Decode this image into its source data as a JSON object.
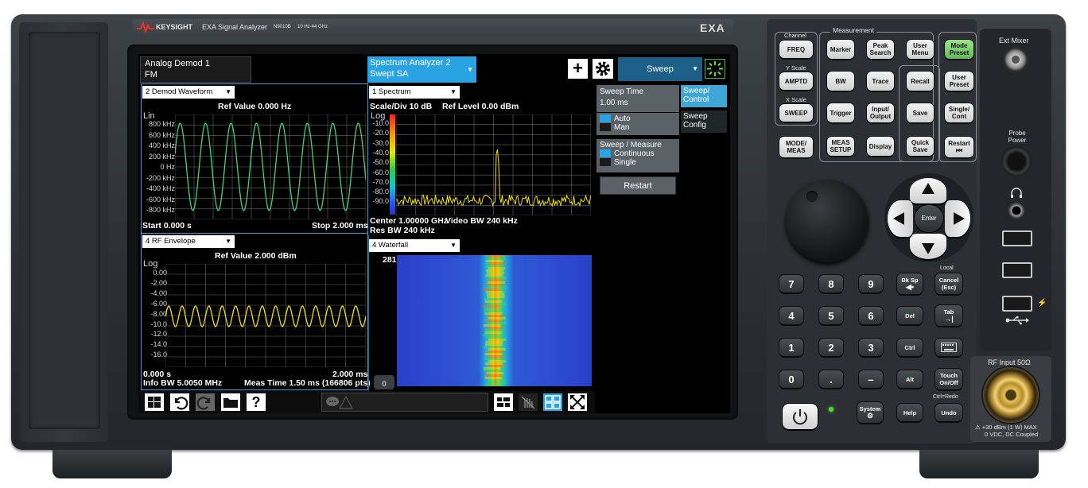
{
  "brand": {
    "name": "KEYSIGHT",
    "product": "EXA Signal Analyzer",
    "model": "N9010B",
    "range": "10 Hz-44 GHz",
    "badge": "EXA"
  },
  "screen": {
    "tabs": [
      {
        "line1": "Analog Demod 1",
        "line2": "FM"
      },
      {
        "line1": "Spectrum Analyzer 2",
        "line2": "Swept SA"
      }
    ],
    "add_label": "+",
    "menu_title": "Sweep",
    "panels": {
      "demod_waveform": {
        "selector": "2 Demod Waveform",
        "ref": "Ref Value 0.000 Hz",
        "scale_type": "Lin",
        "y_ticks": [
          "800 kHz",
          "600 kHz",
          "400 kHz",
          "200 kHz",
          "0 Hz",
          "-200 kHz",
          "-400 kHz",
          "-600 kHz",
          "-800 kHz"
        ],
        "start": "Start 0.000 s",
        "stop": "Stop 2.000 ms"
      },
      "rf_envelope": {
        "selector": "4 RF Envelope",
        "ref": "Ref Value 2.000 dBm",
        "scale_type": "Log",
        "y_ticks": [
          "0.00",
          "-2.00",
          "-4.00",
          "-6.00",
          "-8.00",
          "-10.0",
          "-12.0",
          "-14.0",
          "-16.0"
        ],
        "start": "0.000 s",
        "stop": "2.000 ms",
        "info_bw": "Info BW 5.0050 MHz",
        "meas_time": "Meas Time 1.50 ms (166806 pts)"
      },
      "spectrum": {
        "selector": "1 Spectrum",
        "scale_div": "Scale/Div 10 dB",
        "ref_level": "Ref Level 0.00 dBm",
        "scale_type": "Log",
        "y_ticks": [
          "-10.0",
          "-20.0",
          "-30.0",
          "-40.0",
          "-50.0",
          "-60.0",
          "-70.0",
          "-80.0",
          "-90.0"
        ],
        "center": "Center 1.00000 GHz",
        "video_bw": "Video BW 240 kHz",
        "res_bw": "Res BW 240 kHz"
      },
      "waterfall": {
        "selector": "4 Waterfall",
        "count": "281",
        "zero": "0"
      }
    },
    "softkeys": {
      "sweep_time_label": "Sweep Time",
      "sweep_time_value": "1.00 ms",
      "auto": "Auto",
      "man": "Man",
      "sweep_measure": "Sweep / Measure",
      "continuous": "Continuous",
      "single": "Single",
      "restart": "Restart",
      "side_tabs": [
        {
          "l1": "Sweep/",
          "l2": "Control"
        },
        {
          "l1": "Sweep",
          "l2": "Config"
        }
      ]
    },
    "taskbar": {
      "help": "?"
    }
  },
  "front_panel": {
    "group_labels": {
      "channel": "Channel",
      "measurement": "Measurement",
      "y_scale": "Y Scale",
      "x_scale": "X Scale",
      "local": "Local",
      "ctrl_redo": "Ctrl=Redo"
    },
    "keys": {
      "freq": "FREQ",
      "amptd": "AMPTD",
      "sweep": "SWEEP",
      "mode_meas": "MODE/ MEAS",
      "marker": "Marker",
      "peak_search": "Peak Search",
      "user_menu": "User Menu",
      "bw": "BW",
      "trace": "Trace",
      "recall": "Recall",
      "trigger": "Trigger",
      "input_output": "Input/ Output",
      "save": "Save",
      "meas_setup": "MEAS SETUP",
      "display": "Display",
      "quick_save": "Quick Save",
      "mode_preset": "Mode Preset",
      "user_preset": "User Preset",
      "single_cont": "Single/ Cont",
      "restart": "Restart"
    },
    "enter": "Enter",
    "numpad": [
      "7",
      "8",
      "9",
      "4",
      "5",
      "6",
      "1",
      "2",
      "3",
      "0",
      ".",
      "–"
    ],
    "edit_keys": {
      "bksp": "Bk Sp",
      "cancel": "Cancel (Esc)",
      "del": "Del",
      "tab": "Tab",
      "ctrl": "Ctrl",
      "alt": "Alt",
      "touch": "Touch On/Off",
      "help": "Help",
      "undo": "Undo",
      "system": "System"
    },
    "ports": {
      "ext_mixer": "Ext Mixer",
      "probe_power": "Probe Power",
      "rf_input": "RF Input 50Ω",
      "rf_warning_1": "⚠ +30 dBm (1 W) MAX",
      "rf_warning_2": "0 VDC, DC Coupled"
    }
  },
  "colors": {
    "accent": "#2aa3e2",
    "trace_green": "#3fd37a",
    "trace_yellow": "#f0e000",
    "softkey_panel": "#3fa7d8"
  }
}
